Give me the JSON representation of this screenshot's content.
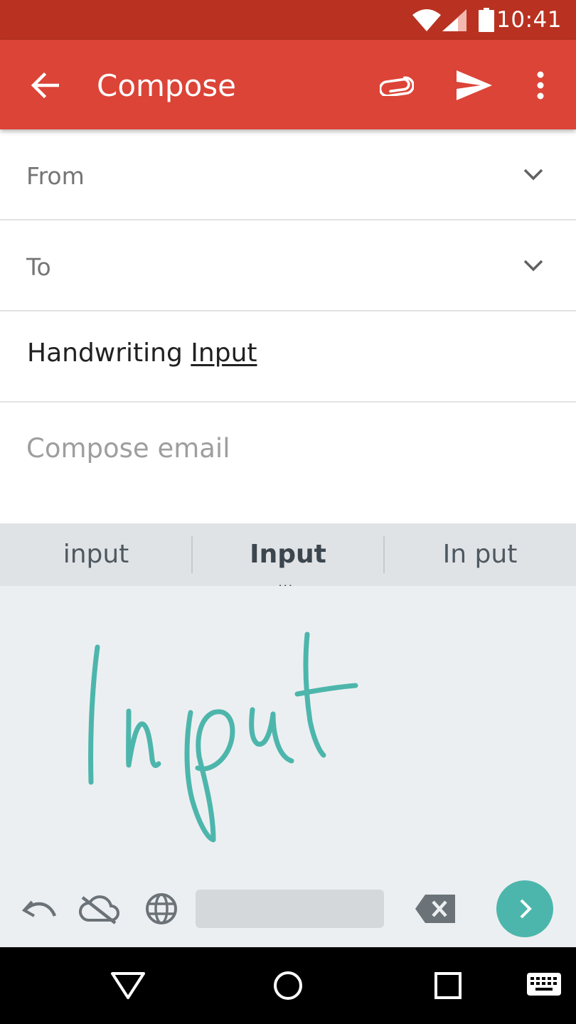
{
  "status_bar": {
    "time": "10:41",
    "icons": [
      "wifi-icon",
      "signal-icon",
      "battery-icon"
    ]
  },
  "app_bar": {
    "title": "Compose",
    "icons": [
      "back-arrow-icon",
      "attach-icon",
      "send-icon",
      "more-vert-icon"
    ]
  },
  "form": {
    "from_label": "From",
    "to_label": "To",
    "subject_part1": "Handwriting ",
    "subject_part2": "Input",
    "body_placeholder": "Compose email"
  },
  "keyboard": {
    "suggestions": [
      "input",
      "Input",
      "In put"
    ],
    "selected_index": 1,
    "more_indicator": "...",
    "handwritten_ink": "Input",
    "toolbar_icons": [
      "undo-icon",
      "cloud-off-icon",
      "globe-icon",
      "spacebar",
      "backspace-icon",
      "go-arrow-icon"
    ]
  },
  "nav_bar": {
    "icons": [
      "back-triangle-icon",
      "home-circle-icon",
      "recents-square-icon",
      "keyboard-icon"
    ]
  },
  "colors": {
    "status_bar": "#b93221",
    "app_bar": "#db4437",
    "ink": "#4db6ac",
    "keyboard_bg": "#eceff1",
    "suggestion_bg": "#e0e3e6"
  }
}
